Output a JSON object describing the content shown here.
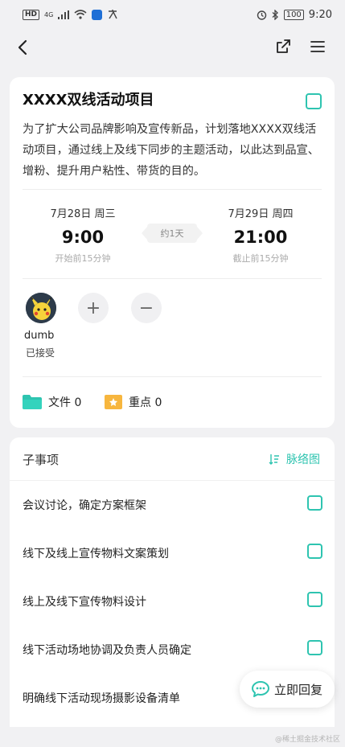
{
  "status_bar": {
    "hd": "HD",
    "network": "4G",
    "battery": "100",
    "time": "9:20"
  },
  "nav": {
    "back_icon": "back-arrow-icon",
    "share_icon": "share-icon",
    "menu_icon": "menu-icon"
  },
  "event": {
    "title": "XXXX双线活动项目",
    "description": "为了扩大公司品牌影响及宣传新品，计划落地XXXX双线活动项目，通过线上及线下同步的主题活动，以此达到品宣、增粉、提升用户粘性、带货的目的。",
    "start": {
      "date": "7月28日 周三",
      "time": "9:00",
      "note": "开始前15分钟"
    },
    "duration": "约1天",
    "end": {
      "date": "7月29日 周四",
      "time": "21:00",
      "note": "截止前15分钟"
    }
  },
  "members": {
    "list": [
      {
        "name": "dumb",
        "status": "已接受"
      }
    ],
    "add_label": "+",
    "remove_label": "−"
  },
  "attachments": {
    "files_label": "文件 0",
    "keypoints_label": "重点 0"
  },
  "sub_items": {
    "title": "子事项",
    "link_label": "脉络图",
    "items": [
      "会议讨论，确定方案框架",
      "线下及线上宣传物料文案策划",
      "线上及线下宣传物料设计",
      "线下活动场地协调及负责人员确定",
      "明确线下活动现场摄影设备清单"
    ]
  },
  "reply_button": "立即回复",
  "watermark": "@稀土掘金技术社区",
  "colors": {
    "accent": "#2ec4b0",
    "background": "#f1f1f3"
  }
}
